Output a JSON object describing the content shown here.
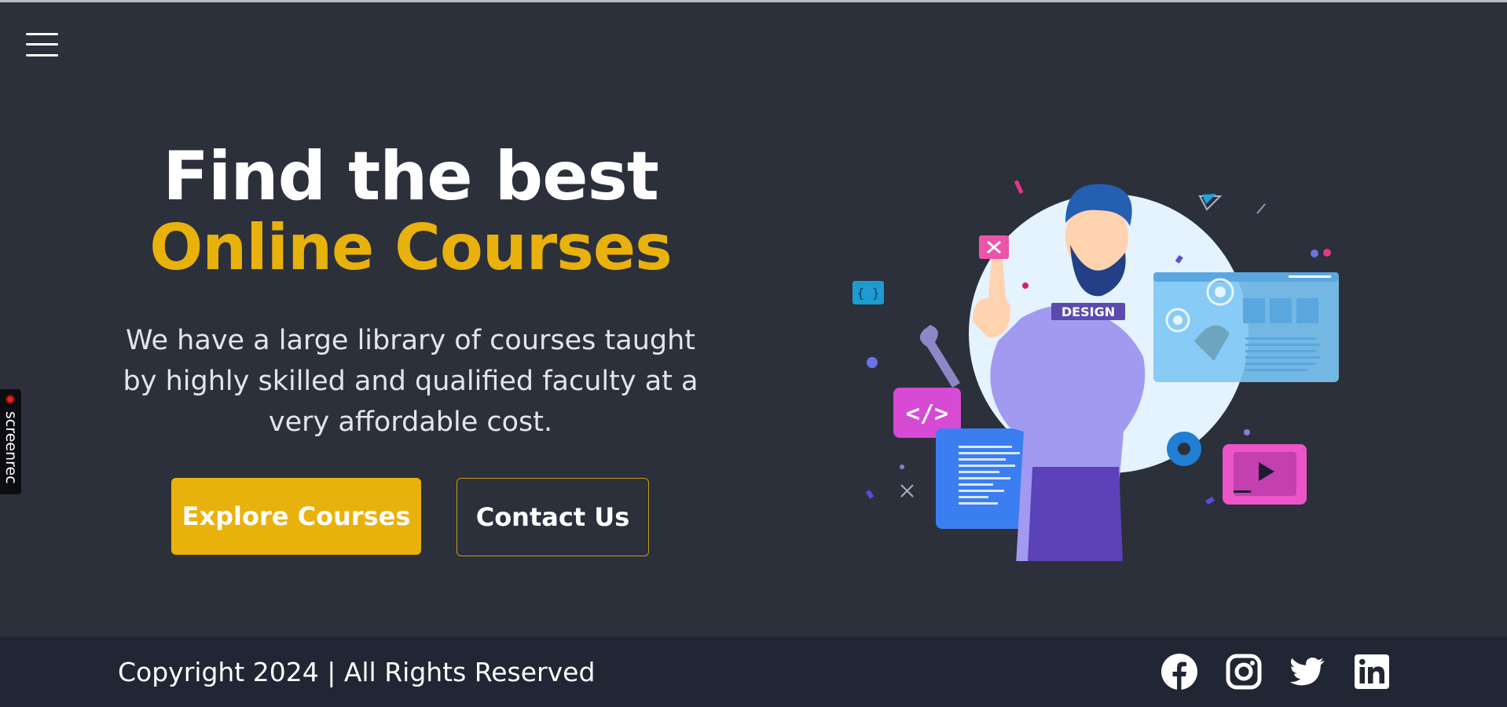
{
  "hero": {
    "title_line1": "Find the best",
    "title_line2": "Online Courses",
    "description": "We have a large library of courses taught by highly skilled and qualified faculty at a very affordable cost.",
    "primary_button": "Explore Courses",
    "secondary_button": "Contact Us",
    "illustration_badge": "DESIGN"
  },
  "recorder": {
    "label": "screenrec"
  },
  "footer": {
    "copyright": "Copyright 2024 | All Rights Reserved"
  },
  "social": [
    "facebook-icon",
    "instagram-icon",
    "twitter-icon",
    "linkedin-icon"
  ],
  "colors": {
    "background": "#2b303b",
    "footer": "#212634",
    "accent": "#e9b10c"
  }
}
